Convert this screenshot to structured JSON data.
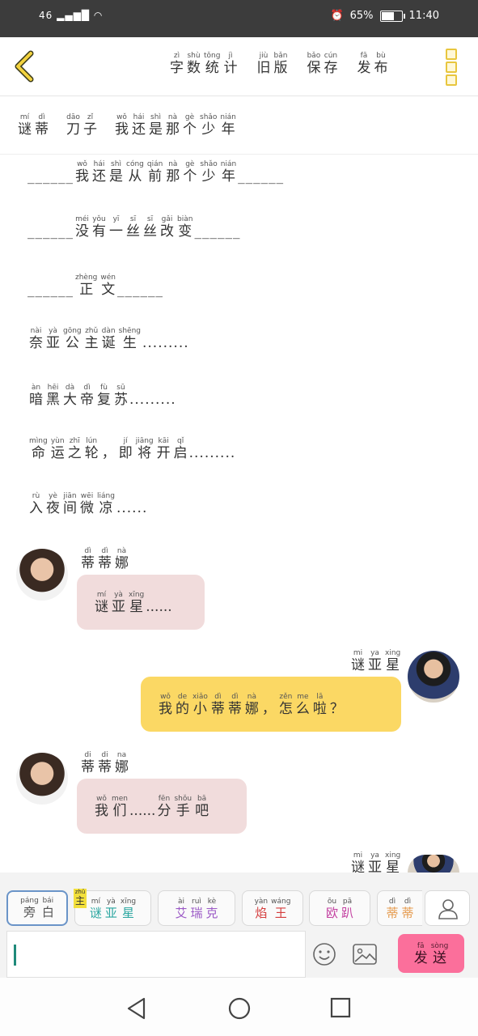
{
  "status_bar": {
    "signal": "46",
    "battery": "65%",
    "time": "11:40"
  },
  "top_menu": [
    {
      "name": "word-count",
      "chars": [
        [
          "zì",
          "字"
        ],
        [
          "shù",
          "数"
        ],
        [
          "tǒng",
          "统"
        ],
        [
          "jì",
          "计"
        ]
      ]
    },
    {
      "name": "old-version",
      "chars": [
        [
          "jiù",
          "旧"
        ],
        [
          "bǎn",
          "版"
        ]
      ]
    },
    {
      "name": "save",
      "chars": [
        [
          "bǎo",
          "保"
        ],
        [
          "cún",
          "存"
        ]
      ]
    },
    {
      "name": "publish",
      "chars": [
        [
          "fā",
          "发"
        ],
        [
          "bù",
          "布"
        ]
      ]
    }
  ],
  "title_row": [
    [
      [
        "mí",
        "谜"
      ],
      [
        "dì",
        "蒂"
      ]
    ],
    [
      [
        "dāo",
        "刀"
      ],
      [
        "zǐ",
        "子"
      ]
    ],
    [
      [
        "wǒ",
        "我"
      ],
      [
        "hái",
        "还"
      ],
      [
        "shì",
        "是"
      ],
      [
        "nà",
        "那"
      ],
      [
        "gè",
        "个"
      ],
      [
        "shǎo",
        "少"
      ],
      [
        "nián",
        "年"
      ]
    ]
  ],
  "story_lines": [
    {
      "pre": "______",
      "chars": [
        [
          "wǒ",
          "我"
        ],
        [
          "hái",
          "还"
        ],
        [
          "shì",
          "是"
        ],
        [
          "cóng",
          "从"
        ],
        [
          "qián",
          "前"
        ],
        [
          "nà",
          "那"
        ],
        [
          "gè",
          "个"
        ],
        [
          "shǎo",
          "少"
        ],
        [
          "nián",
          "年"
        ]
      ],
      "post": "______"
    },
    {
      "pre": "______",
      "chars": [
        [
          "méi",
          "没"
        ],
        [
          "yǒu",
          "有"
        ],
        [
          "yī",
          "一"
        ],
        [
          "sī",
          "丝"
        ],
        [
          "sī",
          "丝"
        ],
        [
          "gǎi",
          "改"
        ],
        [
          "biàn",
          "变"
        ]
      ],
      "post": "______"
    },
    {
      "pre": "______",
      "chars": [
        [
          "zhèng",
          "正"
        ],
        [
          "wén",
          "文"
        ]
      ],
      "post": "______"
    },
    {
      "pre": "",
      "chars": [
        [
          "nài",
          "奈"
        ],
        [
          "yà",
          "亚"
        ],
        [
          "gōng",
          "公"
        ],
        [
          "zhǔ",
          "主"
        ],
        [
          "dàn",
          "诞"
        ],
        [
          "shēng",
          "生"
        ]
      ],
      "post": "........."
    },
    {
      "pre": "",
      "chars": [
        [
          "àn",
          "暗"
        ],
        [
          "hēi",
          "黑"
        ],
        [
          "dà",
          "大"
        ],
        [
          "dì",
          "帝"
        ],
        [
          "fù",
          "复"
        ],
        [
          "sū",
          "苏"
        ]
      ],
      "post": "........."
    },
    {
      "pre": "",
      "chars": [
        [
          "mìng",
          "命"
        ],
        [
          "yùn",
          "运"
        ],
        [
          "zhī",
          "之"
        ],
        [
          "lún",
          "轮"
        ],
        [
          "",
          "，"
        ],
        [
          "jí",
          "即"
        ],
        [
          "jiāng",
          "将"
        ],
        [
          "kāi",
          "开"
        ],
        [
          "qǐ",
          "启"
        ]
      ],
      "post": "........."
    },
    {
      "pre": "",
      "chars": [
        [
          "rù",
          "入"
        ],
        [
          "yè",
          "夜"
        ],
        [
          "jiān",
          "间"
        ],
        [
          "wēi",
          "微"
        ],
        [
          "liáng",
          "凉"
        ]
      ],
      "post": "......"
    }
  ],
  "messages": [
    {
      "side": "left",
      "speaker": [
        [
          "dì",
          "蒂"
        ],
        [
          "dì",
          "蒂"
        ],
        [
          "nà",
          "娜"
        ]
      ],
      "text": [
        [
          "mí",
          "谜"
        ],
        [
          "yà",
          "亚"
        ],
        [
          "xīng",
          "星"
        ]
      ],
      "tail": "......"
    },
    {
      "side": "right",
      "speaker": [
        [
          "mi",
          "谜"
        ],
        [
          "ya",
          "亚"
        ],
        [
          "xing",
          "星"
        ]
      ],
      "text": [
        [
          "wǒ",
          "我"
        ],
        [
          "de",
          "的"
        ],
        [
          "xiǎo",
          "小"
        ],
        [
          "dì",
          "蒂"
        ],
        [
          "dì",
          "蒂"
        ],
        [
          "nà",
          "娜"
        ],
        [
          "",
          "，"
        ],
        [
          "zěn",
          "怎"
        ],
        [
          "me",
          "么"
        ],
        [
          "lā",
          "啦"
        ],
        [
          "",
          "？"
        ]
      ],
      "tail": ""
    },
    {
      "side": "left",
      "speaker": [
        [
          "di",
          "蒂"
        ],
        [
          "di",
          "蒂"
        ],
        [
          "na",
          "娜"
        ]
      ],
      "text": [
        [
          "wǒ",
          "我"
        ],
        [
          "men",
          "们"
        ]
      ],
      "mid": "......",
      "text2": [
        [
          "fēn",
          "分"
        ],
        [
          "shǒu",
          "手"
        ],
        [
          "bā",
          "吧"
        ]
      ]
    },
    {
      "side": "right",
      "speaker": [
        [
          "mi",
          "谜"
        ],
        [
          "ya",
          "亚"
        ],
        [
          "xing",
          "星"
        ]
      ]
    }
  ],
  "roles": [
    {
      "label": [
        [
          "páng",
          "旁"
        ],
        [
          "bái",
          "白"
        ]
      ],
      "color": "#555555",
      "selected": true
    },
    {
      "label": [
        [
          "mí",
          "谜"
        ],
        [
          "yà",
          "亚"
        ],
        [
          "xīng",
          "星"
        ]
      ],
      "color": "#2aa6a0",
      "badge": [
        "zhǔ",
        "主"
      ]
    },
    {
      "label": [
        [
          "ài",
          "艾"
        ],
        [
          "ruì",
          "瑞"
        ],
        [
          "kè",
          "克"
        ]
      ],
      "color": "#9b59c6"
    },
    {
      "label": [
        [
          "yàn",
          "焰"
        ],
        [
          "wáng",
          "王"
        ]
      ],
      "color": "#d43c3c"
    },
    {
      "label": [
        [
          "ōu",
          "欧"
        ],
        [
          "pā",
          "趴"
        ]
      ],
      "color": "#c33fa0"
    },
    {
      "label": [
        [
          "dì",
          "蒂"
        ],
        [
          "dì",
          "蒂"
        ]
      ],
      "color": "#e59a4c"
    }
  ],
  "composer": {
    "input_value": "",
    "send": [
      [
        "fā",
        "发"
      ],
      [
        "sòng",
        "送"
      ]
    ],
    "send_color": "#fb6f9b",
    "icons": [
      "emoji-icon",
      "image-icon",
      "person-icon"
    ]
  },
  "nav": [
    "back-triangle-icon",
    "home-circle-icon",
    "recents-square-icon"
  ],
  "colors": {
    "accent_yellow": "#e8c63e",
    "bubble_pink": "#f1dcdc",
    "bubble_yellow": "#fbd864"
  }
}
